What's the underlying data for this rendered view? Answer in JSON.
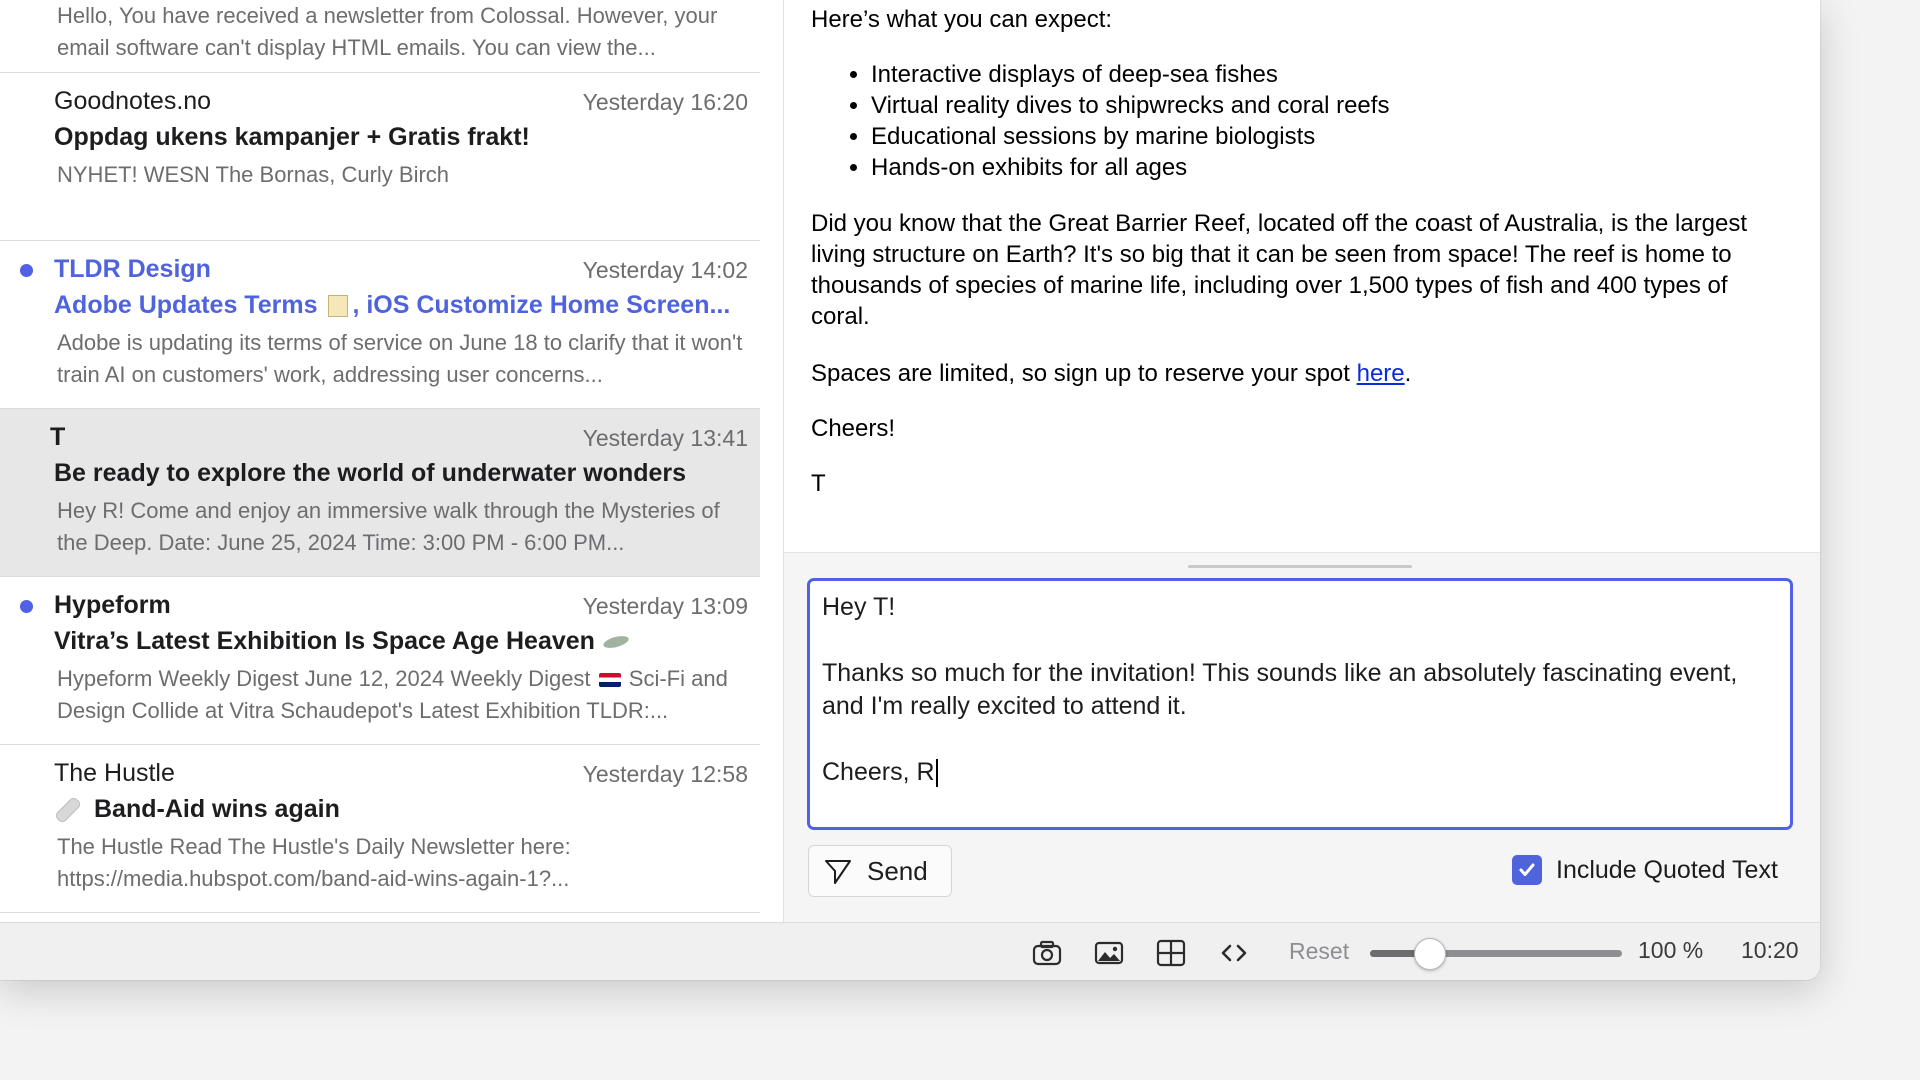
{
  "mail_list": [
    {
      "sender": "",
      "time": "",
      "subject": "",
      "preview": "Hello, You have received a newsletter from Colossal. However, your email software can't display HTML emails. You can view the..."
    },
    {
      "sender": "Goodnotes.no",
      "time": "Yesterday 16:20",
      "subject": "Oppdag ukens kampanjer + Gratis frakt!",
      "preview": "NYHET! WESN The Bornas, Curly Birch"
    },
    {
      "sender": "TLDR Design",
      "time": "Yesterday 14:02",
      "subject_a": "Adobe Updates Terms ",
      "subject_b": ", iOS Customize Home Screen...",
      "preview": "Adobe is updating its terms of service on June 18 to clarify that it won't train AI on customers' work, addressing user concerns..."
    },
    {
      "sender": "T",
      "time": "Yesterday 13:41",
      "subject": "Be ready to explore the world of underwater wonders",
      "preview": "Hey R! Come and enjoy an immersive walk through the Mysteries of the Deep. Date: June 25, 2024 Time: 3:00 PM - 6:00 PM..."
    },
    {
      "sender": "Hypeform",
      "time": "Yesterday 13:09",
      "subject": "Vitra’s Latest Exhibition Is Space Age Heaven",
      "preview_a": "Hypeform Weekly Digest June 12, 2024 Weekly Digest ",
      "preview_b": " Sci-Fi and Design Collide at Vitra Schaudepot's Latest Exhibition TLDR:..."
    },
    {
      "sender": "The Hustle",
      "time": "Yesterday 12:58",
      "subject": "Band-Aid wins again",
      "preview": "The Hustle Read The Hustle's Daily Newsletter here: https://media.hubspot.com/band-aid-wins-again-1?..."
    }
  ],
  "reader": {
    "intro": "Here’s what you can expect:",
    "bullets": [
      "Interactive displays of deep-sea fishes",
      "Virtual reality dives to shipwrecks and coral reefs",
      "Educational sessions by marine biologists",
      "Hands-on exhibits for all ages"
    ],
    "fact": "Did you know that the Great Barrier Reef, located off the coast of Australia, is the largest living structure on Earth? It's so big that it can be seen from space! The reef is home to thousands of species of marine life, including over 1,500 types of fish and 400 types of coral.",
    "signup_text": "Spaces are limited, so sign up to reserve your spot ",
    "signup_link": "here",
    "signup_end": ".",
    "closing": "Cheers!",
    "signature": "T"
  },
  "reply": {
    "text": "Hey T!\n\nThanks so much for the invitation! This sounds like an absolutely fascinating event, and I'm really excited to attend it.\n\nCheers, R",
    "send_label": "Send",
    "include_quoted_label": "Include Quoted Text",
    "include_quoted_checked": true
  },
  "toolbar": {
    "icons": [
      "camera-icon",
      "image-icon",
      "layout-icon",
      "code-icon"
    ],
    "reset_label": "Reset",
    "zoom_value": 0.2,
    "zoom_label": "100 %",
    "clock": "10:20"
  },
  "colors": {
    "accent": "#5161e5",
    "unread_blue": "#4f63dd",
    "link": "#0a2bd5"
  }
}
